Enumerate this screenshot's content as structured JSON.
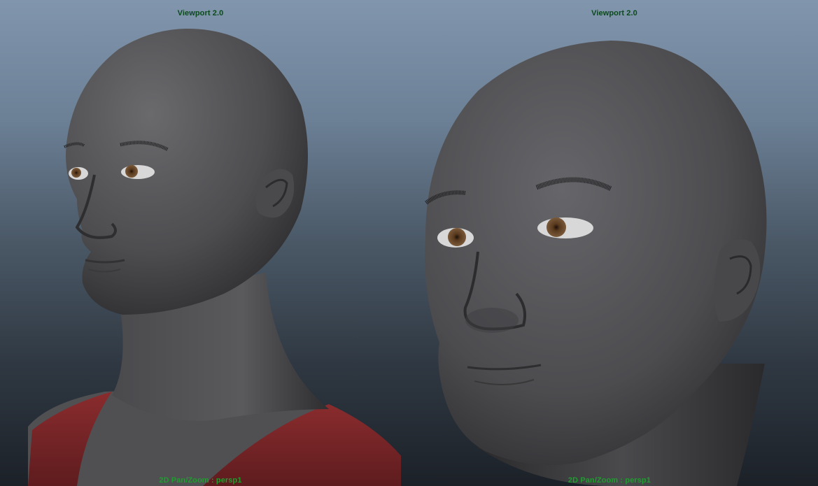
{
  "app": {
    "colors": {
      "title_text": "#0a4a1a",
      "status_text": "#1f9d2f",
      "skin": "#5a5a5c",
      "shirt": "#7a2628",
      "iris": "#6b4a2a"
    }
  },
  "viewports": [
    {
      "title": "Viewport 2.0",
      "status": "2D Pan/Zoom : persp1"
    },
    {
      "title": "Viewport 2.0",
      "status": "2D Pan/Zoom : persp1"
    }
  ]
}
